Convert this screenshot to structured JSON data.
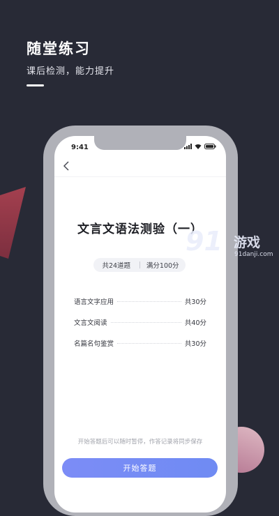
{
  "hero": {
    "title": "随堂练习",
    "subtitle": "课后检测，能力提升"
  },
  "phone": {
    "status": {
      "time": "9:41"
    },
    "quiz": {
      "title": "文言文语法测验（一）",
      "question_count": "共24道题",
      "full_score": "满分100分",
      "sections": [
        {
          "name": "语言文字应用",
          "score": "共30分"
        },
        {
          "name": "文言文阅读",
          "score": "共40分"
        },
        {
          "name": "名篇名句鉴赏",
          "score": "共30分"
        }
      ],
      "note": "开始答题后可以随时暂停，作答记录将同步保存",
      "start_label": "开始答题"
    }
  },
  "watermark": {
    "number": "91",
    "word": "游戏",
    "url": "91danji.com"
  },
  "colors": {
    "background": "#282a36",
    "button": "#7c8cf6",
    "phone_frame": "#b0b1b8",
    "triangle": "#a4404f"
  },
  "icons": [
    "back-chevron-icon",
    "signal-icon",
    "wifi-icon",
    "battery-icon"
  ]
}
